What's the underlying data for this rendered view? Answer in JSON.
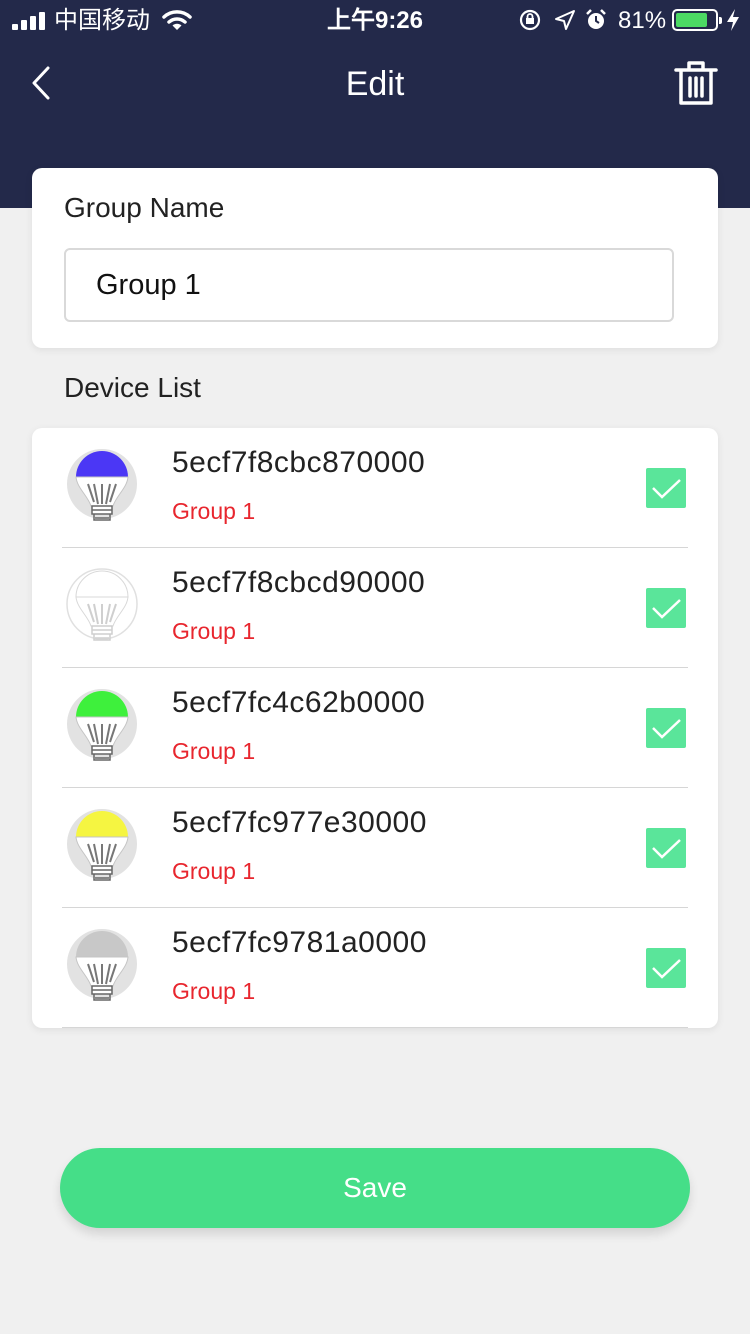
{
  "status_bar": {
    "carrier": "中国移动",
    "time": "上午9:26",
    "battery_percent": "81%",
    "battery_level": 0.81,
    "battery_color": "#4cd964",
    "icons": [
      "orientation-lock-icon",
      "location-icon",
      "alarm-icon",
      "charging-bolt-icon"
    ]
  },
  "nav": {
    "title": "Edit",
    "back_icon": "chevron-left-icon",
    "delete_icon": "trash-icon"
  },
  "group_form": {
    "label": "Group Name",
    "value": "Group 1"
  },
  "device_list": {
    "label": "Device List",
    "devices": [
      {
        "id": "5ecf7f8cbc870000",
        "group": "Group 1",
        "bulb_color": "#4b37f5",
        "checked": true
      },
      {
        "id": "5ecf7f8cbcd90000",
        "group": "Group 1",
        "bulb_color": "#ffffff",
        "checked": true
      },
      {
        "id": "5ecf7fc4c62b0000",
        "group": "Group 1",
        "bulb_color": "#3ef03c",
        "checked": true
      },
      {
        "id": "5ecf7fc977e30000",
        "group": "Group 1",
        "bulb_color": "#f5f541",
        "checked": true
      },
      {
        "id": "5ecf7fc9781a0000",
        "group": "Group 1",
        "bulb_color": "#c8c8c8",
        "checked": true
      }
    ]
  },
  "save_button": {
    "label": "Save",
    "color": "#45de88"
  },
  "colors": {
    "header": "#23294a",
    "background": "#f0f0f0",
    "group_text": "#e8262e",
    "checkbox": "#5ae59a"
  }
}
